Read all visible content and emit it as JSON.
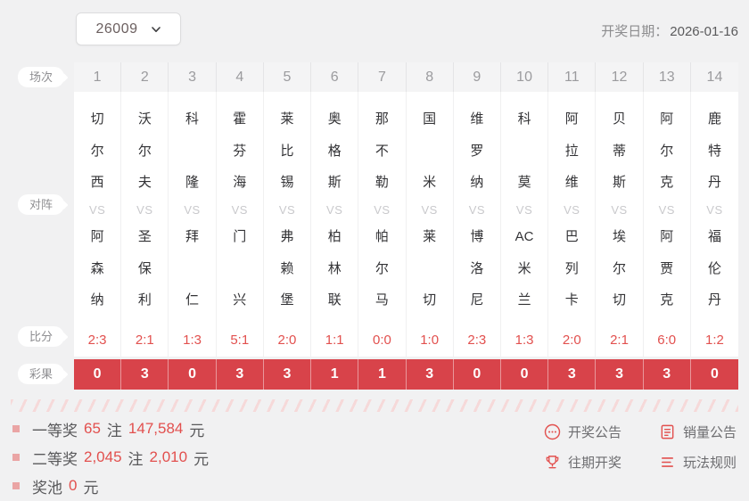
{
  "header": {
    "period_value": "26009",
    "draw_date_label": "开奖日期：",
    "draw_date_value": "2026-01-16"
  },
  "table": {
    "row_labels": {
      "session": "场次",
      "matchup": "对阵",
      "score": "比分",
      "result": "彩果"
    },
    "vs_label": "VS",
    "matches": [
      {
        "no": "1",
        "home": "切尔西",
        "away": "阿森纳",
        "score": "2:3",
        "result": "0"
      },
      {
        "no": "2",
        "home": "沃尔夫",
        "away": "圣保利",
        "score": "2:1",
        "result": "3"
      },
      {
        "no": "3",
        "home": "科隆",
        "away": "拜仁",
        "score": "1:3",
        "result": "0"
      },
      {
        "no": "4",
        "home": "霍芬海",
        "away": "门兴",
        "score": "5:1",
        "result": "3"
      },
      {
        "no": "5",
        "home": "莱比锡",
        "away": "弗赖堡",
        "score": "2:0",
        "result": "3"
      },
      {
        "no": "6",
        "home": "奥格斯",
        "away": "柏林联",
        "score": "1:1",
        "result": "1"
      },
      {
        "no": "7",
        "home": "那不勒",
        "away": "帕尔马",
        "score": "0:0",
        "result": "1"
      },
      {
        "no": "8",
        "home": "国米",
        "away": "莱切",
        "score": "1:0",
        "result": "3"
      },
      {
        "no": "9",
        "home": "维罗纳",
        "away": "博洛尼",
        "score": "2:3",
        "result": "0"
      },
      {
        "no": "10",
        "home": "科莫",
        "away": "AC米兰",
        "score": "1:3",
        "result": "0"
      },
      {
        "no": "11",
        "home": "阿拉维",
        "away": "巴列卡",
        "score": "2:0",
        "result": "3"
      },
      {
        "no": "12",
        "home": "贝蒂斯",
        "away": "埃尔切",
        "score": "2:1",
        "result": "3"
      },
      {
        "no": "13",
        "home": "阿尔克",
        "away": "阿贾克",
        "score": "6:0",
        "result": "3"
      },
      {
        "no": "14",
        "home": "鹿特丹",
        "away": "福伦丹",
        "score": "1:2",
        "result": "0"
      }
    ]
  },
  "prizes": [
    {
      "label": "一等奖",
      "count": "65",
      "count_unit": "注",
      "amount": "147,584",
      "amount_unit": "元"
    },
    {
      "label": "二等奖",
      "count": "2,045",
      "count_unit": "注",
      "amount": "2,010",
      "amount_unit": "元"
    },
    {
      "label": "奖池",
      "count": "",
      "count_unit": "",
      "amount": "0",
      "amount_unit": "元"
    }
  ],
  "links": [
    {
      "icon": "announcement-icon",
      "label": "开奖公告"
    },
    {
      "icon": "sales-report-icon",
      "label": "销量公告"
    },
    {
      "icon": "trophy-icon",
      "label": "往期开奖"
    },
    {
      "icon": "rules-icon",
      "label": "玩法规则"
    }
  ],
  "colors": {
    "accent_red": "#d8434a",
    "score_red": "#e2504e",
    "page_bg": "#f1f1f2"
  }
}
